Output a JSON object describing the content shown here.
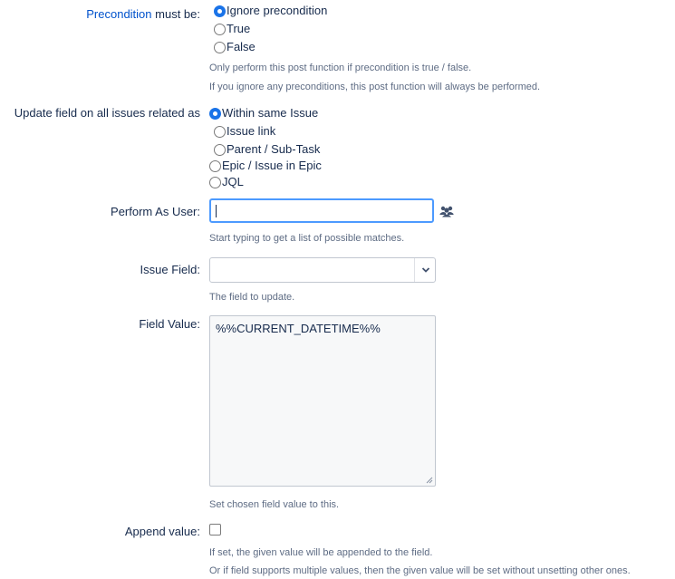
{
  "precondition": {
    "label_link": "Precondition",
    "label_rest": " must be:",
    "options": [
      "Ignore precondition",
      "True",
      "False"
    ],
    "selected": "Ignore precondition",
    "help": [
      "Only perform this post function if precondition is true / false.",
      "If you ignore any preconditions, this post function will always be performed."
    ]
  },
  "related": {
    "label": "Update field on all issues related as",
    "options": [
      "Within same Issue",
      "Issue link",
      "Parent / Sub-Task",
      "Epic / Issue in Epic",
      "JQL"
    ],
    "selected": "Within same Issue"
  },
  "perform_as_user": {
    "label": "Perform As User:",
    "value": "",
    "icon": "users-icon",
    "help": "Start typing to get a list of possible matches."
  },
  "issue_field": {
    "label": "Issue Field:",
    "value": "",
    "icon": "chevron-down-icon",
    "help": "The field to update."
  },
  "field_value": {
    "label": "Field Value:",
    "value": "%%CURRENT_DATETIME%%",
    "help": "Set chosen field value to this."
  },
  "append_value": {
    "label": "Append value:",
    "checked": false,
    "help": [
      "If set, the given value will be appended to the field.",
      "Or if field supports multiple values, then the given value will be set without unsetting other ones."
    ]
  },
  "colors": {
    "accent": "#1a73e8",
    "link": "#0052cc",
    "focus_border": "#4c9aff",
    "help_text": "#5e6c84"
  }
}
